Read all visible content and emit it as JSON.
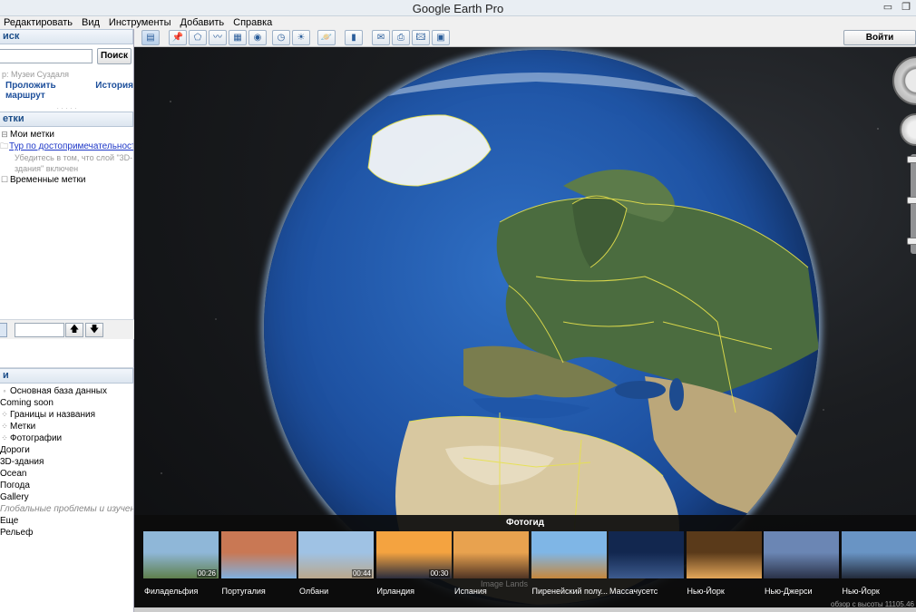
{
  "window": {
    "title": "Google Earth Pro"
  },
  "menu": [
    {
      "label": "Редактировать"
    },
    {
      "label": "Вид"
    },
    {
      "label": "Инструменты"
    },
    {
      "label": "Добавить"
    },
    {
      "label": "Справка"
    }
  ],
  "search": {
    "header": "иск",
    "button": "Поиск",
    "hint": "р: Музеи Суздаля",
    "link_route": "Проложить маршрут",
    "link_history": "История"
  },
  "places": {
    "header": "етки",
    "my_places": "Мои метки",
    "tour_link": "Тур по достопримечательност",
    "tour_note_1": "Убедитесь в том, что слой \"3D-",
    "tour_note_2": "здания\" включен",
    "temp_places": "Временные метки"
  },
  "layers": {
    "header": "и",
    "items": [
      {
        "label": "Основная база данных",
        "indent": 1
      },
      {
        "label": "Coming soon",
        "indent": 0
      },
      {
        "label": "Границы и названия",
        "indent": 2
      },
      {
        "label": "Метки",
        "indent": 2
      },
      {
        "label": "Фотографии",
        "indent": 2
      },
      {
        "label": "Дороги",
        "indent": 0
      },
      {
        "label": "3D-здания",
        "indent": 0
      },
      {
        "label": "Ocean",
        "indent": 0
      },
      {
        "label": "Погода",
        "indent": 0
      },
      {
        "label": "Gallery",
        "indent": 0
      },
      {
        "label": "Глобальные проблемы и изучение с",
        "indent": 0,
        "italic": true
      },
      {
        "label": "Еще",
        "indent": 0
      },
      {
        "label": "Рельеф",
        "indent": 0
      }
    ]
  },
  "toolbar": {
    "login": "Войти"
  },
  "photo_guide": {
    "title": "Фотогид",
    "watermark": "Image Lands",
    "coords": "обзор с высоты 11105.46",
    "items": [
      {
        "label": "Филадельфия",
        "duration": "00:26",
        "color1": "#8fb7d8",
        "color2": "#5f7f4d"
      },
      {
        "label": "Португалия",
        "duration": "",
        "color1": "#c97854",
        "color2": "#7fb0df"
      },
      {
        "label": "Олбани",
        "duration": "00:44",
        "color1": "#9fc2e4",
        "color2": "#b9a78c"
      },
      {
        "label": "Ирландия",
        "duration": "00:30",
        "color1": "#f4a340",
        "color2": "#2a2d3d"
      },
      {
        "label": "Испания",
        "duration": "",
        "color1": "#e8a24f",
        "color2": "#503424"
      },
      {
        "label": "Пиренейский полу...",
        "duration": "",
        "color1": "#7fb6e6",
        "color2": "#c6873c"
      },
      {
        "label": "Массачусетс",
        "duration": "",
        "color1": "#12274f",
        "color2": "#3c5a8d"
      },
      {
        "label": "Нью-Йорк",
        "duration": "",
        "color1": "#5a3a1a",
        "color2": "#e2a65a"
      },
      {
        "label": "Нью-Джерси",
        "duration": "",
        "color1": "#6b86b4",
        "color2": "#2a3248"
      },
      {
        "label": "Нью-Йорк",
        "duration": "",
        "color1": "#6994c4",
        "color2": "#222a3a"
      }
    ]
  },
  "colors": {
    "title_bar": "#e9eef3",
    "panel_header_text": "#1e4f8a",
    "link": "#1d4f9b",
    "globe_ocean": "#1f54a5"
  }
}
